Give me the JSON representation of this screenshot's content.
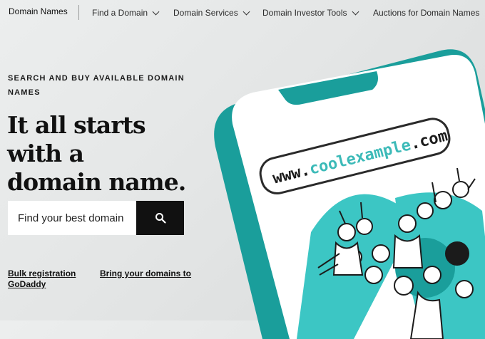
{
  "nav": {
    "brand": "Domain Names",
    "items": [
      {
        "label": "Find a Domain"
      },
      {
        "label": "Domain Services"
      },
      {
        "label": "Domain Investor Tools"
      },
      {
        "label": "Auctions for Domain Names"
      }
    ]
  },
  "hero": {
    "eyebrow": "SEARCH AND BUY AVAILABLE DOMAIN NAMES",
    "headline_line1": "It all starts with a",
    "headline_line2": "domain name."
  },
  "search": {
    "placeholder": "Find your best domain",
    "button_icon": "search-icon"
  },
  "links": {
    "bulk": "Bulk registration",
    "bulk_line2": "GoDaddy",
    "transfer": "Bring your domains to"
  },
  "illustration": {
    "url_part1": "www.",
    "url_part2": "coolexample",
    "url_part3": ".com"
  },
  "colors": {
    "accent": "#1a9e9b",
    "teal_light": "#3cc6c4",
    "button": "#111111"
  }
}
